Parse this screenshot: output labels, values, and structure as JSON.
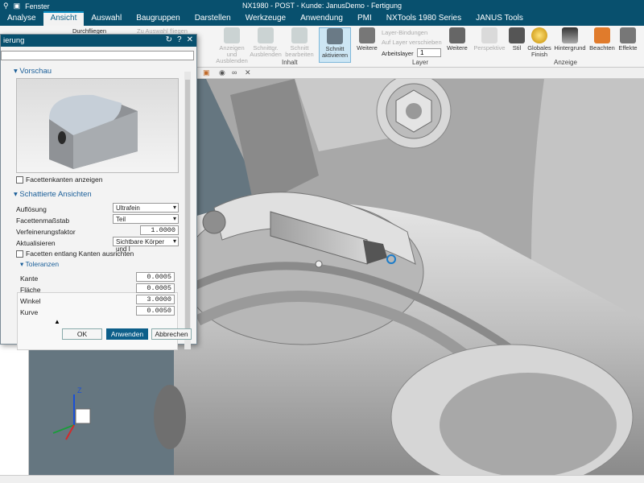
{
  "window": {
    "title": "NX1980 - POST - Kunde: JanusDemo - Fertigung",
    "menu": "Fenster"
  },
  "tabs": [
    "Analyse",
    "Ansicht",
    "Auswahl",
    "Baugruppen",
    "Darstellen",
    "Werkzeuge",
    "Anwendung",
    "PMI",
    "NXTools 1980 Series",
    "JANUS Tools"
  ],
  "ribbon": {
    "durchfliegen": "Durchfliegen",
    "zu_auswahl": "Zu Auswahl fliegen",
    "buttons": [
      {
        "label": "Anzeigen und Ausblenden"
      },
      {
        "label": "Schnittgr. Ausblenden"
      },
      {
        "label": "Schnitt bearbeiten"
      },
      {
        "label": "Schnitt aktivieren"
      },
      {
        "label": "Weitere"
      },
      {
        "label": "Weitere"
      },
      {
        "label": "Perspektive"
      },
      {
        "label": "Stil"
      },
      {
        "label": "Globales Finish"
      },
      {
        "label": "Hintergrund"
      },
      {
        "label": "Beachten"
      },
      {
        "label": "Effekte"
      }
    ],
    "layer": {
      "bindungen": "Layer-Bindungen",
      "verschieben": "Auf Layer verschieben",
      "arbeitslayer": "Arbeitslayer",
      "arbeitslayer_value": "1"
    },
    "groups": {
      "inhalt": "Inhalt",
      "layer": "Layer",
      "anzeige": "Anzeige"
    }
  },
  "dialog": {
    "title": "ierung",
    "vorschau": "Vorschau",
    "facetten_anzeigen": "Facettenkanten anzeigen",
    "schattierte": "Schattierte Ansichten",
    "aufloesung_label": "Auflösung",
    "aufloesung_value": "Ultrafein",
    "facettenmassstab_label": "Facettenmaßstab",
    "facettenmassstab_value": "Teil",
    "verfeinerung_label": "Verfeinerungsfaktor",
    "verfeinerung_value": "1.0000",
    "aktualisieren_label": "Aktualisieren",
    "aktualisieren_value": "Sichtbare Körper und I",
    "facetten_kanten": "Facetten entlang Kanten ausrichten",
    "toleranzen": "Toleranzen",
    "kante_label": "Kante",
    "kante_value": "0.0005",
    "flaeche_label": "Fläche",
    "flaeche_value": "0.0005",
    "winkel_label": "Winkel",
    "winkel_value": "3.0000",
    "kurve_label": "Kurve",
    "kurve_value": "0.0050",
    "ok": "OK",
    "anwenden": "Anwenden",
    "abbrechen": "Abbrechen"
  },
  "axes": {
    "z": "Z"
  }
}
